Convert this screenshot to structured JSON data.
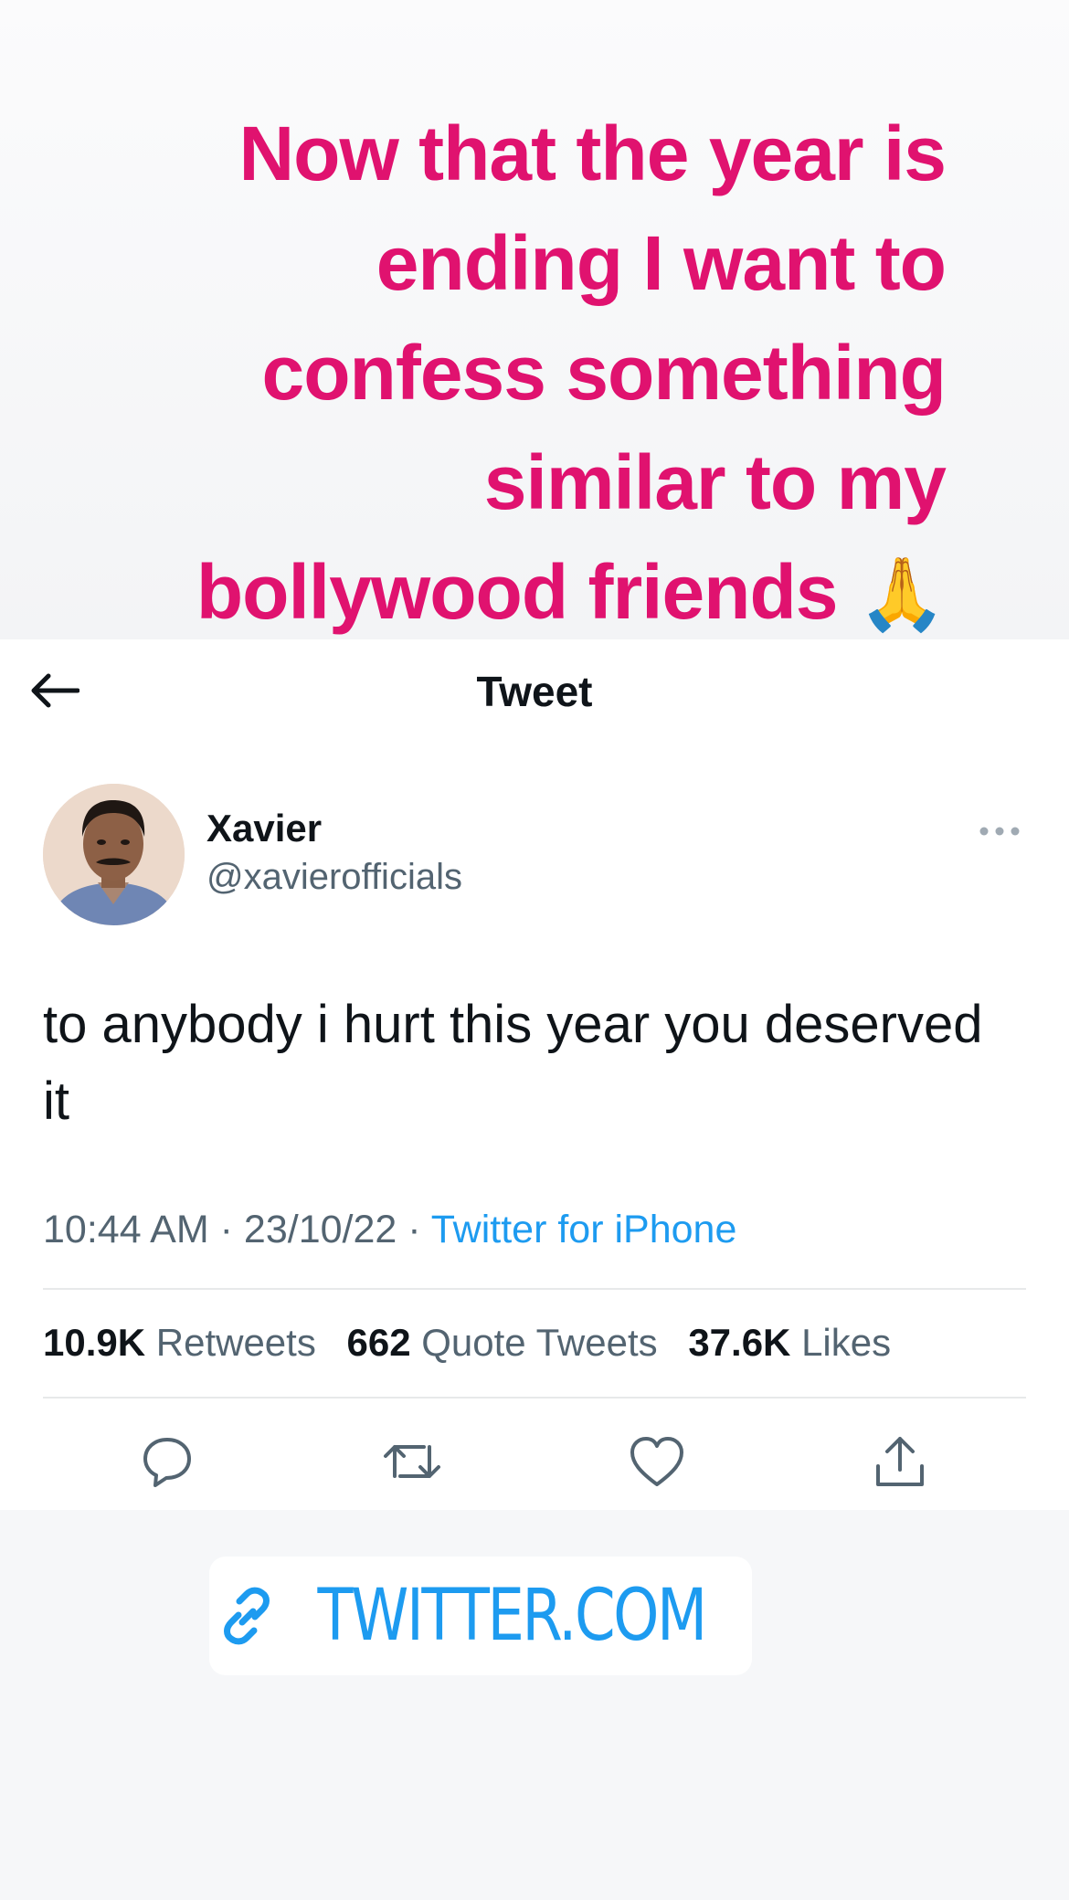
{
  "caption": {
    "lines": [
      "Now that the year is",
      "ending I want to",
      "confess something",
      "similar to my",
      "bollywood friends"
    ],
    "emoji": "🙏"
  },
  "header": {
    "title": "Tweet",
    "back_icon": "arrow-left-icon"
  },
  "tweet": {
    "display_name": "Xavier",
    "handle": "@xavierofficials",
    "text": "to anybody i hurt this year you deserved it",
    "time": "10:44 AM",
    "separator": "·",
    "date": "23/10/22",
    "source": "Twitter for iPhone",
    "stats": {
      "retweets_count": "10.9K",
      "retweets_label": "Retweets",
      "quotes_count": "662",
      "quotes_label": "Quote Tweets",
      "likes_count": "37.6K",
      "likes_label": "Likes"
    },
    "actions": [
      "reply-icon",
      "retweet-icon",
      "like-icon",
      "share-icon"
    ]
  },
  "link_sticker": {
    "label": "TWITTER.COM",
    "icon": "link-icon"
  },
  "colors": {
    "caption": "#e0126f",
    "link": "#1d9bf0",
    "text_primary": "#0f1419",
    "text_secondary": "#536471"
  }
}
